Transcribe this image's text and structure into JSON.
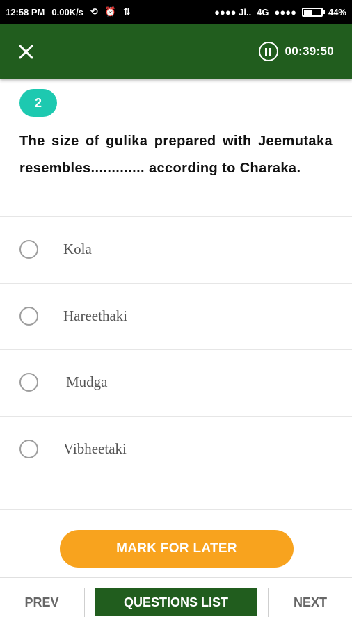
{
  "status_bar": {
    "time": "12:58 PM",
    "speed": "0.00K/s",
    "signal1": "●●●● Ji..",
    "network": "4G",
    "signal2": "●●●●",
    "battery": "44%"
  },
  "app_bar": {
    "close_icon": "close-icon",
    "timer_icon": "pause-circle-icon",
    "timer": "00:39:50",
    "color": "#215d1e"
  },
  "question": {
    "number": "2",
    "text": "The size of gulika prepared with Jeemutaka resembles............. according to Charaka."
  },
  "options": [
    {
      "label": "Kola"
    },
    {
      "label": "Hareethaki"
    },
    {
      "label": "Mudga"
    },
    {
      "label": "Vibheetaki"
    }
  ],
  "mark_for_later": {
    "label": "MARK FOR LATER",
    "color": "#f8a31e"
  },
  "bottom_nav": {
    "prev": "PREV",
    "questions_list": "QUESTIONS LIST",
    "next": "NEXT"
  }
}
